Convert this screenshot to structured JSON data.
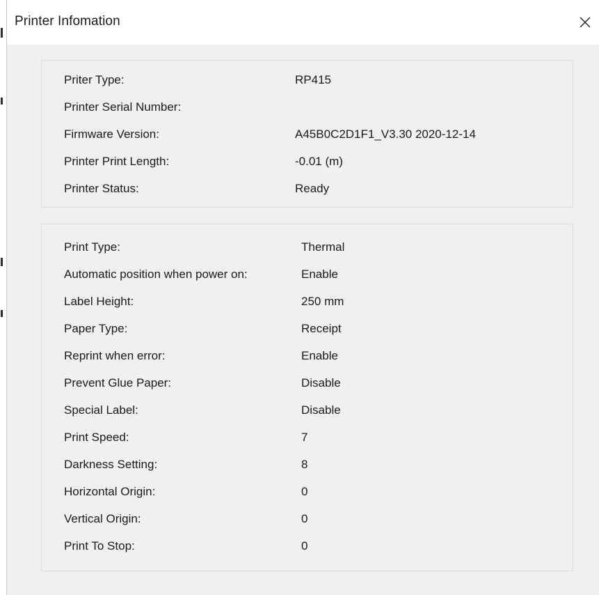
{
  "window": {
    "title": "Printer Infomation"
  },
  "printer_info": [
    {
      "label": "Priter Type:",
      "value": "RP415"
    },
    {
      "label": "Printer Serial Number:",
      "value": ""
    },
    {
      "label": "Firmware Version:",
      "value": "A45B0C2D1F1_V3.30 2020-12-14"
    },
    {
      "label": "Printer Print Length:",
      "value": "-0.01 (m)"
    },
    {
      "label": "Printer Status:",
      "value": "Ready"
    }
  ],
  "settings": [
    {
      "label": "Print Type:",
      "value": "Thermal"
    },
    {
      "label": "Automatic position when power on:",
      "value": "Enable"
    },
    {
      "label": "Label Height:",
      "value": "250 mm"
    },
    {
      "label": "Paper Type:",
      "value": "Receipt"
    },
    {
      "label": "Reprint when error:",
      "value": "Enable"
    },
    {
      "label": "Prevent Glue Paper:",
      "value": "Disable"
    },
    {
      "label": "Special Label:",
      "value": "Disable"
    },
    {
      "label": "Print Speed:",
      "value": "7"
    },
    {
      "label": "Darkness Setting:",
      "value": "8"
    },
    {
      "label": "Horizontal Origin:",
      "value": "0"
    },
    {
      "label": "Vertical Origin:",
      "value": "0"
    },
    {
      "label": "Print To Stop:",
      "value": "0"
    }
  ],
  "icons": {
    "close": "close-icon"
  }
}
